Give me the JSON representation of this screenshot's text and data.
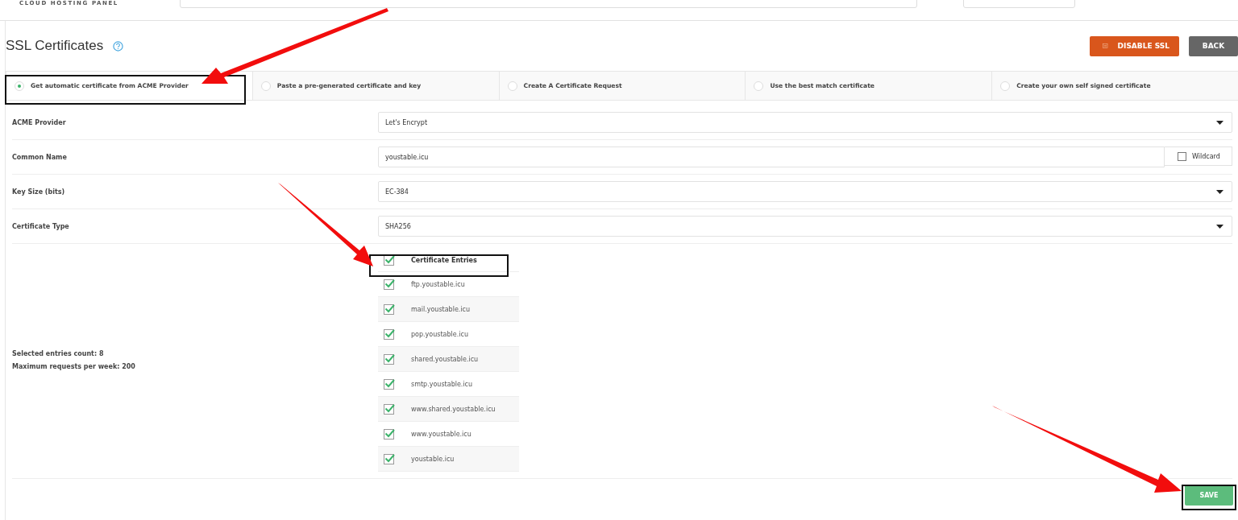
{
  "header": {
    "brand": "CLOUD HOSTING PANEL"
  },
  "page": {
    "title": "SSL Certificates"
  },
  "actions": [
    {
      "kind": "disable",
      "label": "DISABLE SSL"
    },
    {
      "kind": "back",
      "label": "BACK"
    }
  ],
  "tabs": [
    {
      "label": "Get automatic certificate from ACME Provider",
      "selected": true
    },
    {
      "label": "Paste a pre-generated certificate and key",
      "selected": false
    },
    {
      "label": "Create A Certificate Request",
      "selected": false
    },
    {
      "label": "Use the best match certificate",
      "selected": false
    },
    {
      "label": "Create your own self signed certificate",
      "selected": false
    }
  ],
  "fields": [
    {
      "kind": "select",
      "label": "ACME Provider",
      "value": "Let's Encrypt"
    },
    {
      "kind": "text",
      "label": "Common Name",
      "value": "youstable.icu",
      "option": {
        "label": "Wildcard",
        "checked": false
      }
    },
    {
      "kind": "select",
      "label": "Key Size (bits)",
      "value": "EC-384"
    },
    {
      "kind": "select",
      "label": "Certificate Type",
      "value": "SHA256"
    }
  ],
  "summary": [
    "Selected entries count: 8",
    "Maximum requests per week: 200"
  ],
  "entries": {
    "heading": "Certificate Entries",
    "all_checked": true,
    "rows": [
      {
        "name": "ftp.youstable.icu",
        "checked": true
      },
      {
        "name": "mail.youstable.icu",
        "checked": true
      },
      {
        "name": "pop.youstable.icu",
        "checked": true
      },
      {
        "name": "shared.youstable.icu",
        "checked": true
      },
      {
        "name": "smtp.youstable.icu",
        "checked": true
      },
      {
        "name": "www.shared.youstable.icu",
        "checked": true
      },
      {
        "name": "www.youstable.icu",
        "checked": true
      },
      {
        "name": "youstable.icu",
        "checked": true
      }
    ]
  },
  "save": {
    "label": "SAVE"
  }
}
